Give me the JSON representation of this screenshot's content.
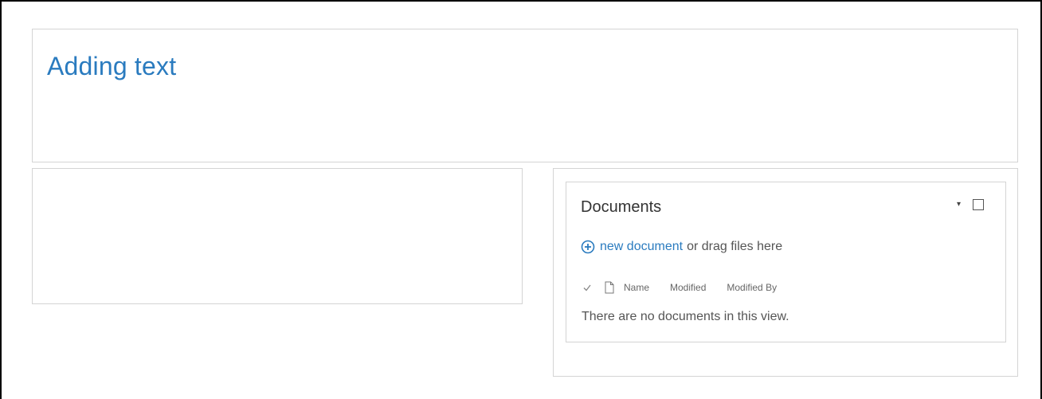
{
  "page": {
    "title": "Adding text"
  },
  "documents_webpart": {
    "title": "Documents",
    "new_document_label": "new document",
    "drag_text": "or drag files here",
    "columns": [
      "Name",
      "Modified",
      "Modified By"
    ],
    "empty_message": "There are no documents in this view."
  },
  "icons": {
    "add": "plus-circle-icon",
    "check": "checkmark-icon",
    "document": "document-icon",
    "menu": "dropdown-arrow-icon"
  },
  "colors": {
    "accent": "#2a7bbf",
    "border": "#d4d4d4",
    "text": "#333333"
  }
}
